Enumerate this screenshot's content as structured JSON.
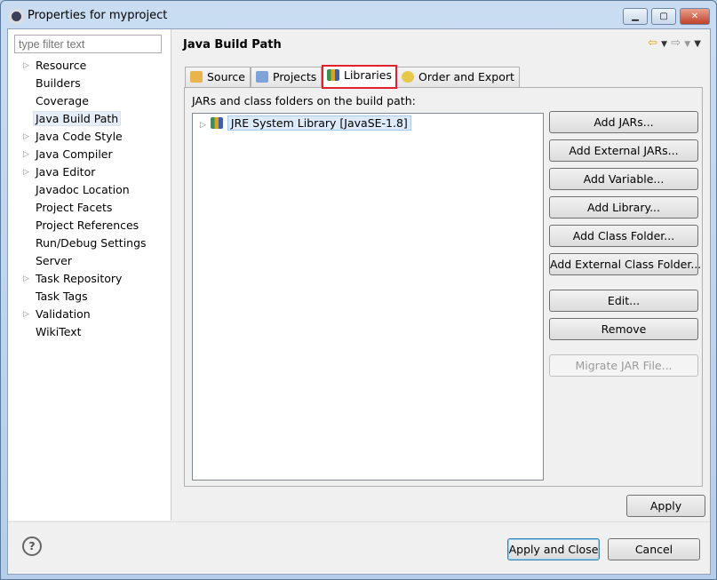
{
  "window": {
    "title": "Properties for myproject",
    "icon": "eclipse-icon",
    "controls": [
      "minimize",
      "maximize",
      "close"
    ]
  },
  "filter": {
    "placeholder": "type filter text"
  },
  "tree": [
    {
      "label": "Resource",
      "expandable": true
    },
    {
      "label": "Builders"
    },
    {
      "label": "Coverage"
    },
    {
      "label": "Java Build Path",
      "selected": true
    },
    {
      "label": "Java Code Style",
      "expandable": true
    },
    {
      "label": "Java Compiler",
      "expandable": true
    },
    {
      "label": "Java Editor",
      "expandable": true
    },
    {
      "label": "Javadoc Location"
    },
    {
      "label": "Project Facets"
    },
    {
      "label": "Project References"
    },
    {
      "label": "Run/Debug Settings"
    },
    {
      "label": "Server"
    },
    {
      "label": "Task Repository",
      "expandable": true
    },
    {
      "label": "Task Tags"
    },
    {
      "label": "Validation",
      "expandable": true
    },
    {
      "label": "WikiText"
    }
  ],
  "page": {
    "title": "Java Build Path"
  },
  "tabs": [
    {
      "label": "Source"
    },
    {
      "label": "Projects"
    },
    {
      "label": "Libraries",
      "active": true
    },
    {
      "label": "Order and Export"
    }
  ],
  "libraries": {
    "label": "JARs and class folders on the build path:",
    "items": [
      {
        "label": "JRE System Library [JavaSE-1.8]"
      }
    ],
    "buttons": [
      "Add JARs...",
      "Add External JARs...",
      "Add Variable...",
      "Add Library...",
      "Add Class Folder...",
      "Add External Class Folder...",
      "Edit...",
      "Remove",
      "Migrate JAR File..."
    ]
  },
  "footer": {
    "apply": "Apply",
    "apply_close": "Apply and Close",
    "cancel": "Cancel"
  },
  "colors": {
    "highlight": "#e0202a"
  }
}
